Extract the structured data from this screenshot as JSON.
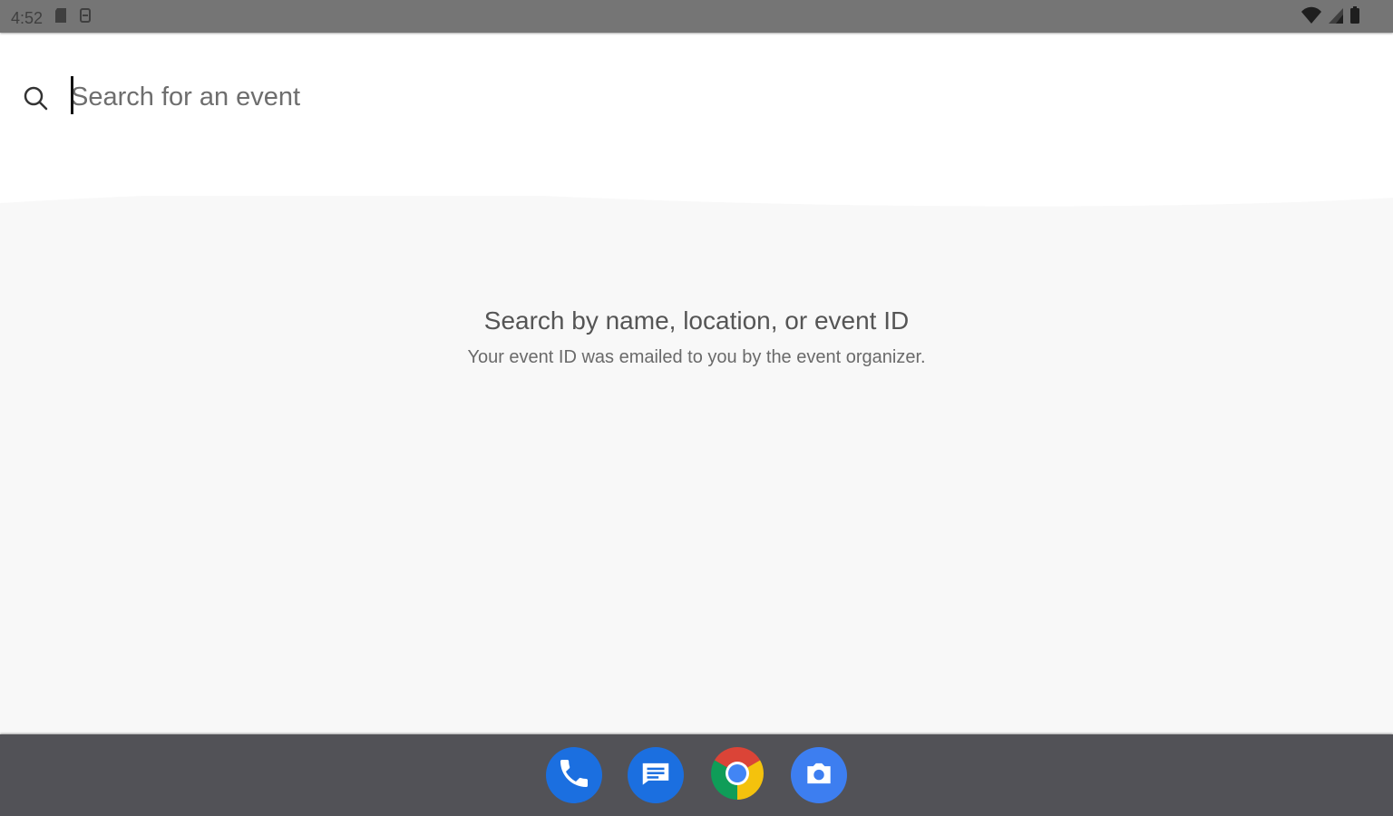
{
  "status_bar": {
    "time": "4:52",
    "left_icons": [
      "sd-card-icon",
      "storage-icon"
    ],
    "right_icons": [
      "wifi-icon",
      "cell-signal-icon",
      "battery-icon"
    ]
  },
  "search": {
    "placeholder": "Search for an event",
    "value": "",
    "icon": "search-icon"
  },
  "empty_state": {
    "title": "Search by name, location, or event ID",
    "subtitle": "Your event ID was emailed to you by the event organizer."
  },
  "dock": {
    "apps": [
      {
        "name": "phone",
        "icon": "phone-icon",
        "color": "#1b6fe0"
      },
      {
        "name": "messages",
        "icon": "messages-icon",
        "color": "#1b6fe0"
      },
      {
        "name": "chrome",
        "icon": "chrome-icon",
        "color": "#db4437"
      },
      {
        "name": "camera",
        "icon": "camera-icon",
        "color": "#3d7ef0"
      }
    ]
  },
  "colors": {
    "status_bar_bg": "#757575",
    "header_bg": "#ffffff",
    "content_bg": "#f8f8f8",
    "dock_bg": "#525257"
  }
}
